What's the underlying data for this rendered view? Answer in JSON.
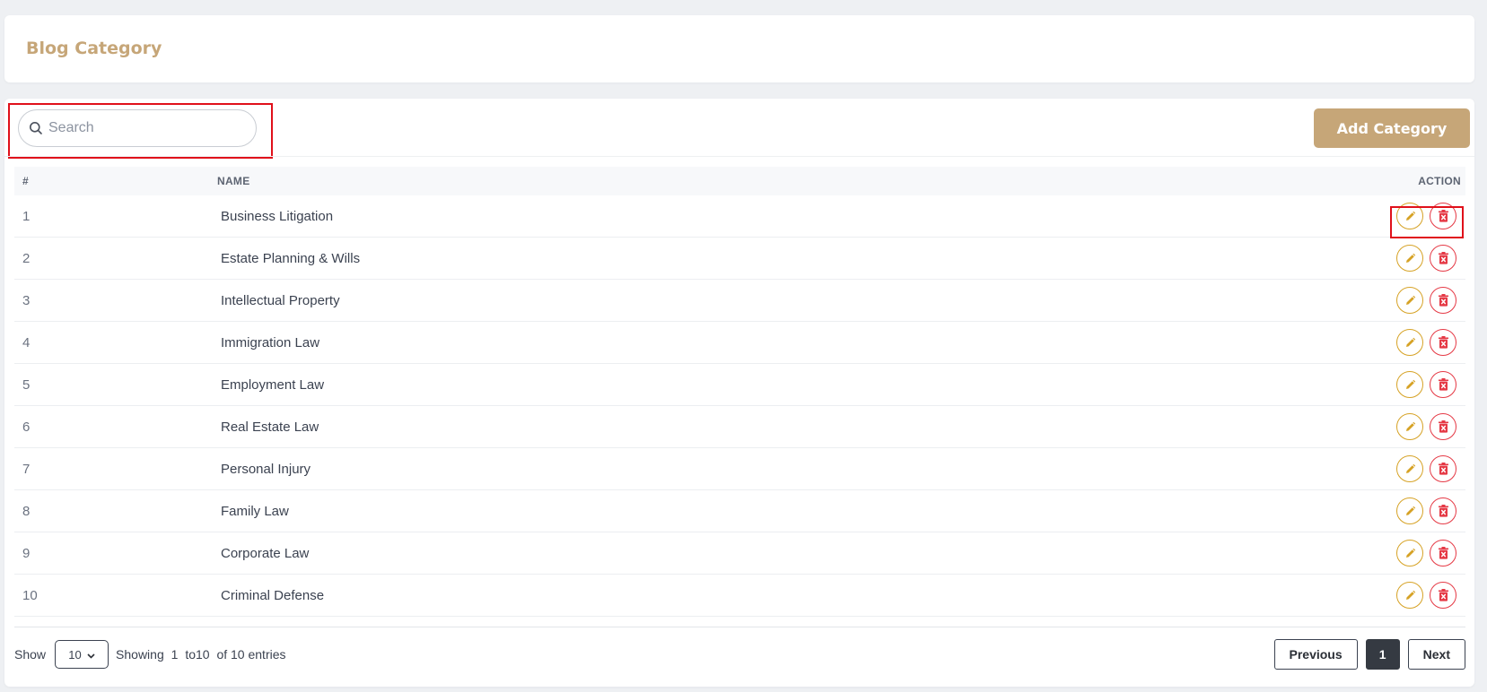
{
  "header": {
    "title": "Blog Category"
  },
  "search": {
    "placeholder": "Search",
    "value": ""
  },
  "toolbar": {
    "add_label": "Add Category"
  },
  "table": {
    "columns": {
      "index": "#",
      "name": "NAME",
      "action": "ACTION"
    },
    "rows": [
      {
        "index": "1",
        "name": "Business Litigation"
      },
      {
        "index": "2",
        "name": "Estate Planning & Wills"
      },
      {
        "index": "3",
        "name": "Intellectual Property"
      },
      {
        "index": "4",
        "name": "Immigration Law"
      },
      {
        "index": "5",
        "name": "Employment Law"
      },
      {
        "index": "6",
        "name": "Real Estate Law"
      },
      {
        "index": "7",
        "name": "Personal Injury"
      },
      {
        "index": "8",
        "name": "Family Law"
      },
      {
        "index": "9",
        "name": "Corporate Law"
      },
      {
        "index": "10",
        "name": "Criminal Defense"
      }
    ],
    "row_actions": {
      "edit_icon": "pencil-icon",
      "delete_icon": "trash-icon"
    }
  },
  "footer": {
    "show_label": "Show",
    "page_size": "10",
    "showing_label": "Showing",
    "from": "1",
    "to": "to10",
    "of_entries": "of 10 entries"
  },
  "pagination": {
    "previous_label": "Previous",
    "current_page": "1",
    "next_label": "Next"
  },
  "colors": {
    "accent": "#c6a678",
    "edit": "#d6a225",
    "delete": "#e53945",
    "highlight": "#e0101a"
  }
}
